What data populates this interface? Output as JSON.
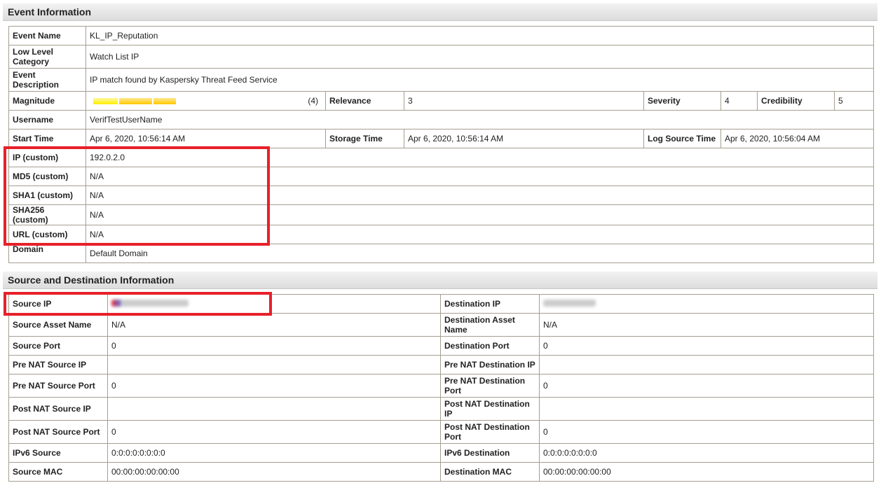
{
  "event": {
    "title": "Event Information",
    "event_name_label": "Event Name",
    "event_name": "KL_IP_Reputation",
    "llc_label": "Low Level Category",
    "llc": "Watch List IP",
    "desc_label": "Event Description",
    "desc": "IP match found by Kaspersky Threat Feed Service",
    "magnitude_label": "Magnitude",
    "magnitude": "(4)",
    "magnitude_level": 4,
    "relevance_label": "Relevance",
    "relevance": "3",
    "severity_label": "Severity",
    "severity": "4",
    "credibility_label": "Credibility",
    "credibility": "5",
    "username_label": "Username",
    "username": "VerifTestUserName",
    "start_label": "Start Time",
    "start": "Apr 6, 2020, 10:56:14 AM",
    "storage_label": "Storage Time",
    "storage": "Apr 6, 2020, 10:56:14 AM",
    "logsrc_label": "Log Source Time",
    "logsrc": "Apr 6, 2020, 10:56:04 AM",
    "custom": [
      {
        "label": "IP (custom)",
        "value": "192.0.2.0"
      },
      {
        "label": "MD5 (custom)",
        "value": "N/A"
      },
      {
        "label": "SHA1 (custom)",
        "value": "N/A"
      },
      {
        "label": "SHA256 (custom)",
        "value": "N/A"
      },
      {
        "label": "URL (custom)",
        "value": "N/A"
      }
    ],
    "domain_label": "Domain",
    "domain": "Default Domain"
  },
  "srcdst": {
    "title": "Source and Destination Information",
    "rows": [
      {
        "l1": "Source IP",
        "v1": "",
        "l2": "Destination IP",
        "v2": ""
      },
      {
        "l1": "Source Asset Name",
        "v1": "N/A",
        "l2": "Destination Asset Name",
        "v2": "N/A"
      },
      {
        "l1": "Source Port",
        "v1": "0",
        "l2": "Destination Port",
        "v2": "0"
      },
      {
        "l1": "Pre NAT Source IP",
        "v1": "",
        "l2": "Pre NAT Destination IP",
        "v2": ""
      },
      {
        "l1": "Pre NAT Source Port",
        "v1": "0",
        "l2": "Pre NAT Destination Port",
        "v2": "0"
      },
      {
        "l1": "Post NAT Source IP",
        "v1": "",
        "l2": "Post NAT Destination IP",
        "v2": ""
      },
      {
        "l1": "Post NAT Source Port",
        "v1": "0",
        "l2": "Post NAT Destination Port",
        "v2": "0"
      },
      {
        "l1": "IPv6 Source",
        "v1": "0:0:0:0:0:0:0:0",
        "l2": "IPv6 Destination",
        "v2": "0:0:0:0:0:0:0:0"
      },
      {
        "l1": "Source MAC",
        "v1": "00:00:00:00:00:00",
        "l2": "Destination MAC",
        "v2": "00:00:00:00:00:00"
      }
    ]
  },
  "colors": {
    "highlight": "#e8202a",
    "border": "#a59f91",
    "bar_yellow": "#ffee00",
    "bar_gold": "#ffc800"
  }
}
